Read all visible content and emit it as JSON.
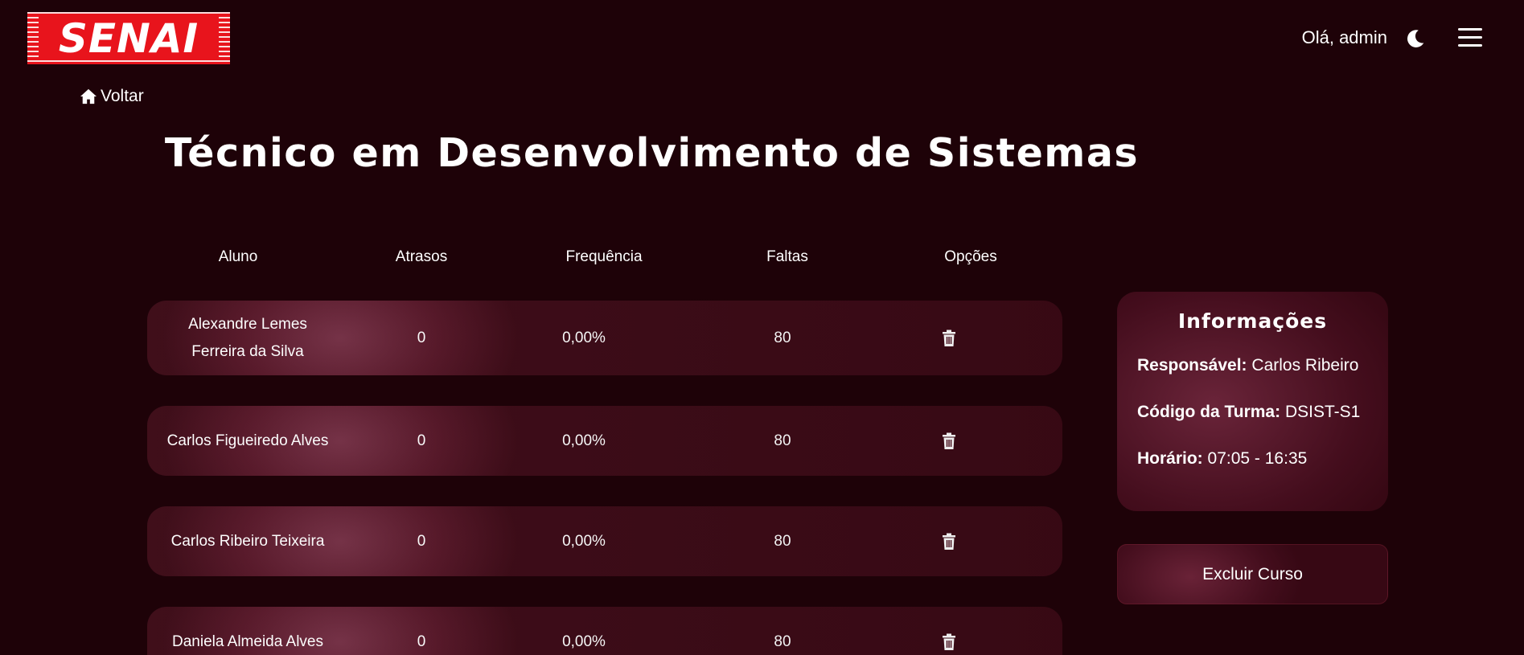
{
  "header": {
    "logo_text": "SENAI",
    "greeting": "Olá, admin",
    "theme_icon": "moon-icon",
    "menu_icon": "hamburger-menu-icon"
  },
  "nav": {
    "back_label": "Voltar",
    "back_icon": "home-icon"
  },
  "page": {
    "title": "Técnico em Desenvolvimento de Sistemas"
  },
  "table": {
    "headers": [
      "Aluno",
      "Atrasos",
      "Frequência",
      "Faltas",
      "Opções"
    ],
    "rows": [
      {
        "name_line1": "Alexandre Lemes",
        "name_line2": "Ferreira da Silva",
        "atrasos": "0",
        "frequencia": "0,00%",
        "faltas": "80"
      },
      {
        "name": "Carlos Figueiredo Alves",
        "atrasos": "0",
        "frequencia": "0,00%",
        "faltas": "80"
      },
      {
        "name": "Carlos Ribeiro Teixeira",
        "atrasos": "0",
        "frequencia": "0,00%",
        "faltas": "80"
      },
      {
        "name": "Daniela Almeida Alves",
        "atrasos": "0",
        "frequencia": "0,00%",
        "faltas": "80"
      }
    ],
    "option_icon": "trash-icon"
  },
  "info": {
    "title": "Informações",
    "responsavel_label": "Responsável:",
    "responsavel_value": "Carlos Ribeiro",
    "codigo_label": "Código da Turma:",
    "codigo_value": "DSIST-S1",
    "horario_label": "Horário:",
    "horario_value": "07:05 - 16:35"
  },
  "actions": {
    "delete_course_label": "Excluir Curso"
  },
  "colors": {
    "background": "#1e0208",
    "logo_red": "#e8141c",
    "card": "#5a182a"
  }
}
